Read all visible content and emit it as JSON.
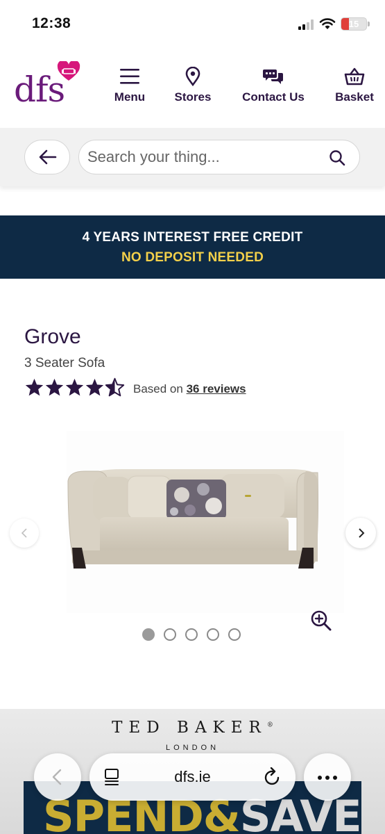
{
  "status_bar": {
    "time": "12:38",
    "battery": "15"
  },
  "header": {
    "logo_text": "dfs",
    "nav": [
      {
        "label": "Menu",
        "icon": "menu-icon"
      },
      {
        "label": "Stores",
        "icon": "location-pin-icon"
      },
      {
        "label": "Contact Us",
        "icon": "chat-bubbles-icon"
      },
      {
        "label": "Basket",
        "icon": "basket-icon"
      }
    ]
  },
  "search": {
    "placeholder": "Search your thing..."
  },
  "promo_banner": {
    "line1": "4 YEARS INTEREST FREE CREDIT",
    "line2": "NO DEPOSIT NEEDED"
  },
  "product": {
    "title": "Grove",
    "subtitle": "3 Seater Sofa",
    "rating": 4.5,
    "reviews_prefix": "Based on",
    "reviews_link": "36 reviews"
  },
  "carousel": {
    "slides": 5,
    "active": 1
  },
  "bottom_promo": {
    "brand": "TED BAKER",
    "brand_sub": "LONDON",
    "headline_a": "SPEND&",
    "headline_b": "SAVE"
  },
  "browser": {
    "url": "dfs.ie"
  },
  "colors": {
    "brand_purple": "#6a1b7a",
    "text_dark_purple": "#2b1642",
    "banner_navy": "#0e2a45",
    "banner_yellow": "#f3d04a",
    "heart_pink": "#d6177b"
  }
}
